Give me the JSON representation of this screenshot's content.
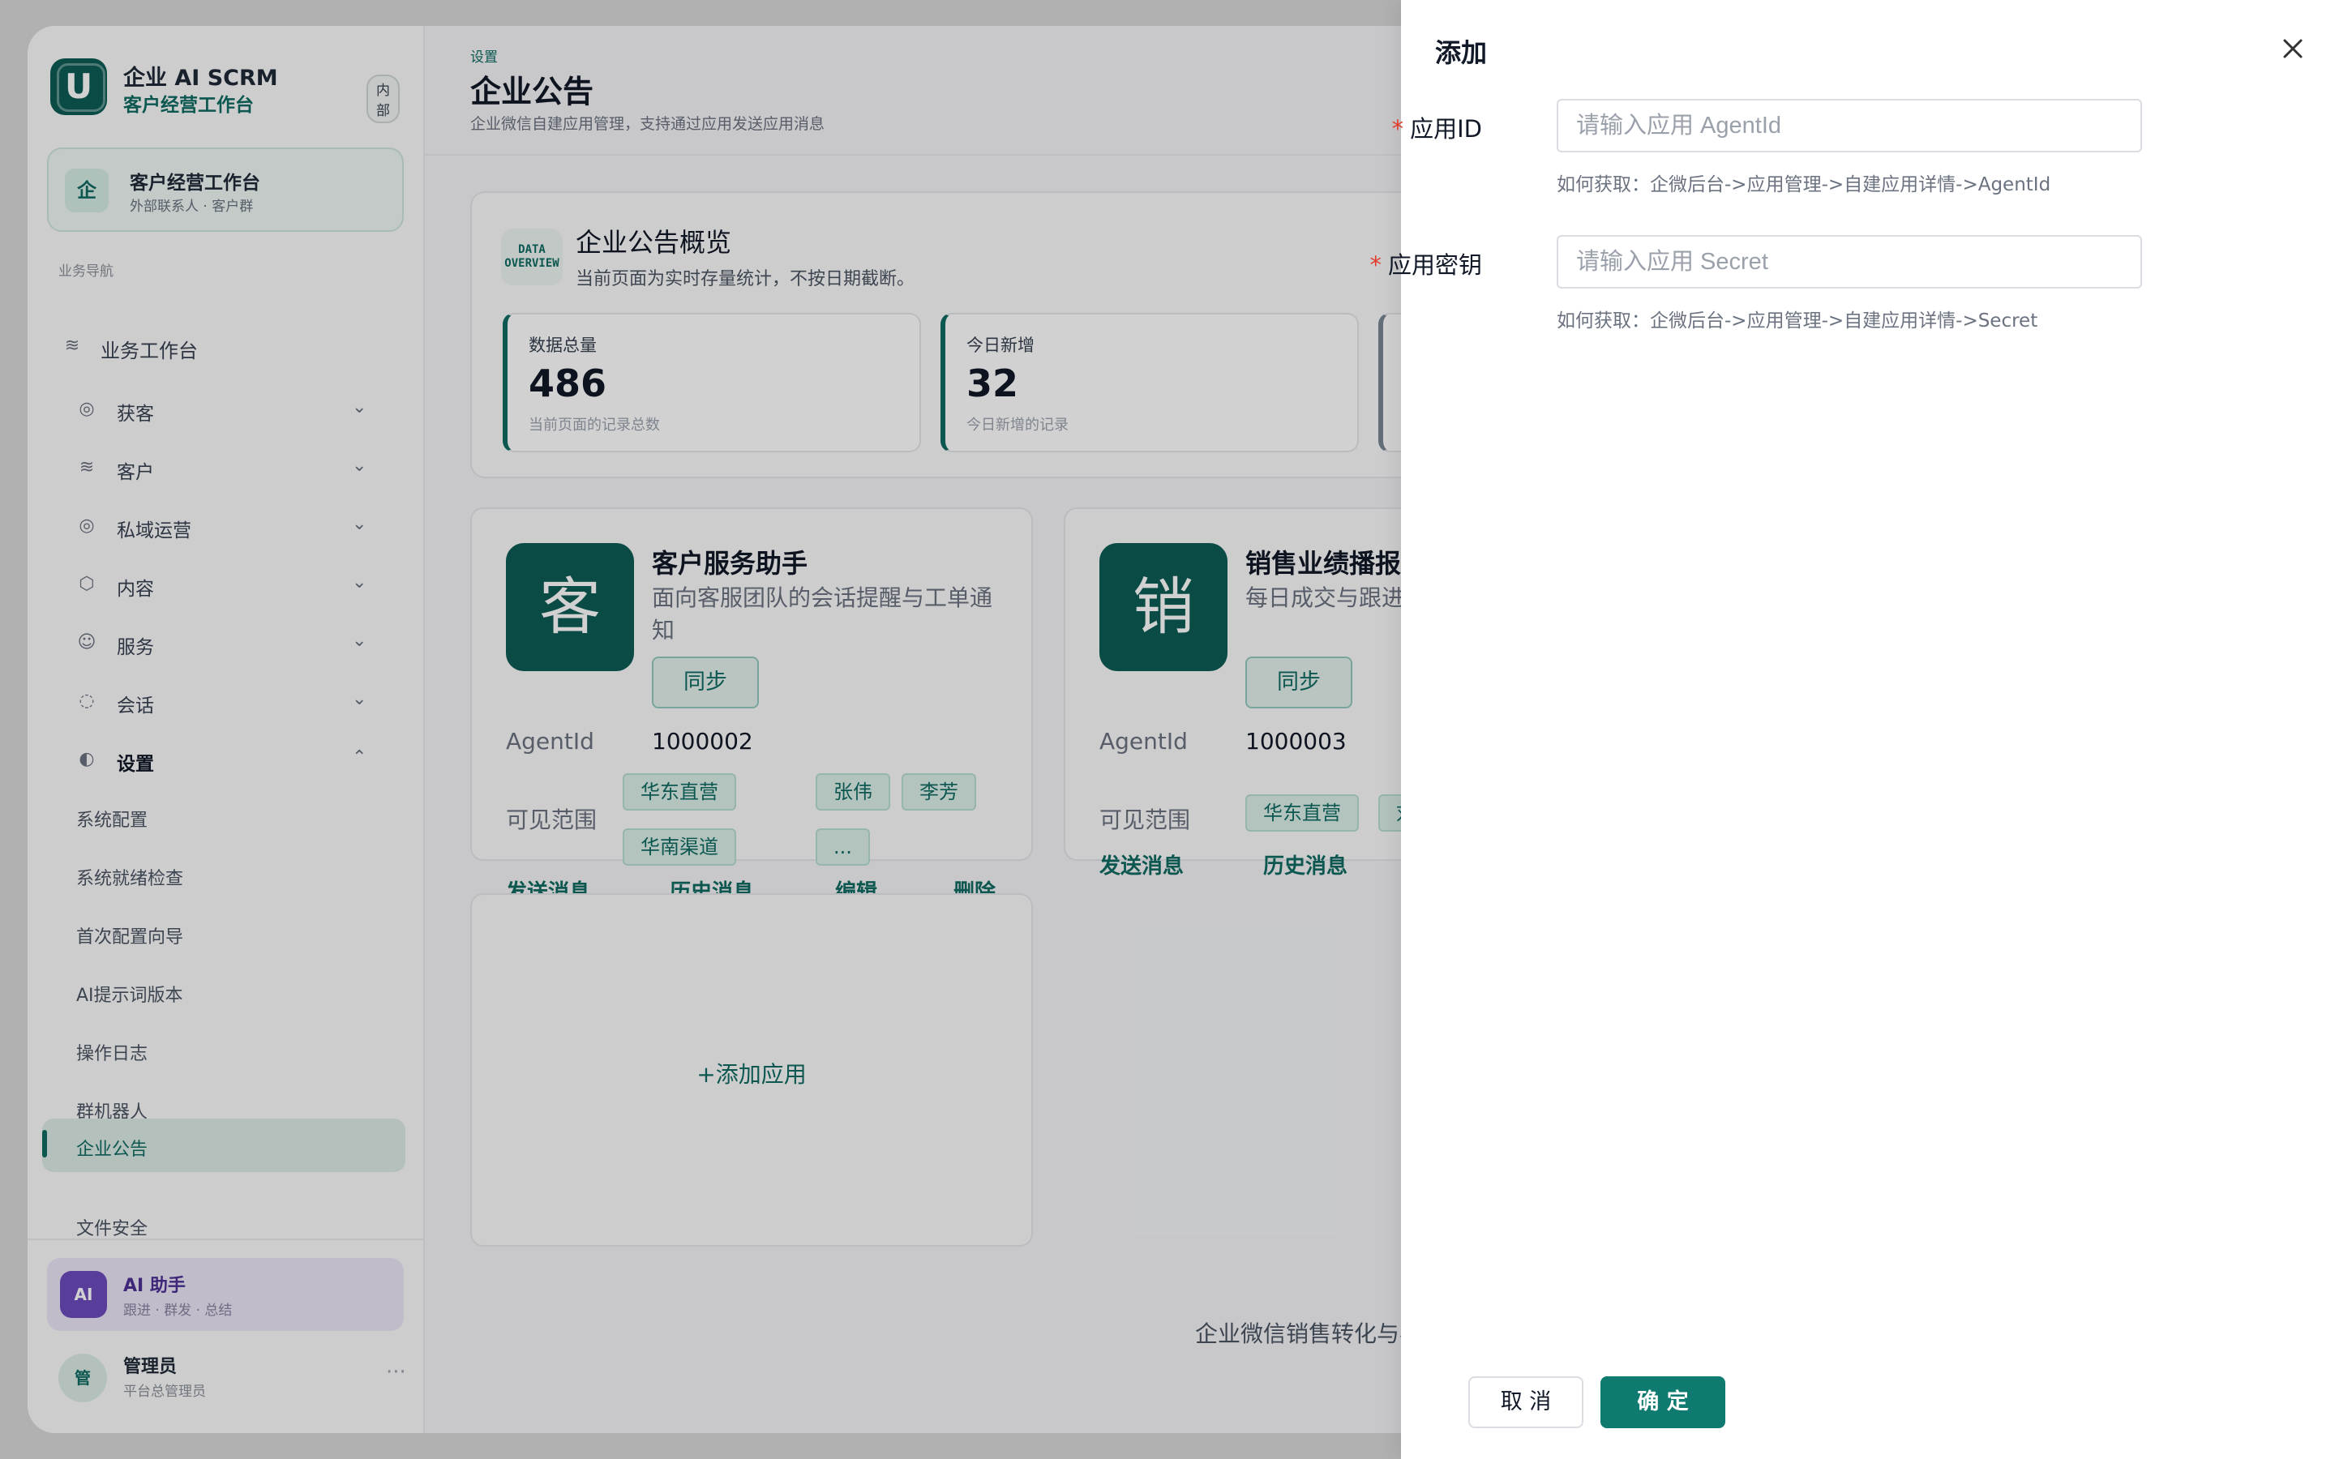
{
  "brand": {
    "name": "企业 AI SCRM",
    "subtitle": "客户经营工作台",
    "badge": "内部",
    "logo_letter": "U"
  },
  "workspace": {
    "icon": "企",
    "title": "客户经营工作台",
    "subtitle": "外部联系人 · 客户群"
  },
  "sidebar": {
    "section_label": "业务导航",
    "top_item": "业务工作台",
    "groups": [
      {
        "label": "获客",
        "icon": "target-icon"
      },
      {
        "label": "客户",
        "icon": "layers-icon"
      },
      {
        "label": "私域运营",
        "icon": "target-icon"
      },
      {
        "label": "内容",
        "icon": "box-icon"
      },
      {
        "label": "服务",
        "icon": "headset-icon"
      },
      {
        "label": "会话",
        "icon": "chat-icon"
      },
      {
        "label": "设置",
        "icon": "settings-icon"
      }
    ],
    "settings_items": [
      "系统配置",
      "系统就绪检查",
      "首次配置向导",
      "AI提示词版本",
      "操作日志",
      "群机器人",
      "企业公告",
      "文件安全"
    ],
    "active_item": "企业公告"
  },
  "ai_assistant": {
    "icon": "AI",
    "title": "AI 助手",
    "subtitle": "跟进 · 群发 · 总结"
  },
  "admin": {
    "avatar": "管",
    "name": "管理员",
    "role": "平台总管理员",
    "more": "···"
  },
  "page": {
    "breadcrumb": "设置",
    "title": "企业公告",
    "description": "企业微信自建应用管理，支持通过应用发送应用消息"
  },
  "overview": {
    "icon_text_1": "DATA",
    "icon_text_2": "OVERVIEW",
    "title": "企业公告概览",
    "description": "当前页面为实时存量统计，不按日期截断。",
    "stats": [
      {
        "label": "数据总量",
        "value": "486",
        "hint": "当前页面的记录总数"
      },
      {
        "label": "今日新增",
        "value": "32",
        "hint": "今日新增的记录"
      }
    ]
  },
  "apps": [
    {
      "icon": "客",
      "name": "客户服务助手",
      "description": "面向客服团队的会话提醒与工单通知",
      "sync": "同步",
      "agent_label": "AgentId",
      "agent_id": "1000002",
      "scope_label": "可见范围",
      "tags": [
        "华东直营",
        "张伟",
        "李芳",
        "华南渠道",
        "..."
      ],
      "actions": [
        "发送消息",
        "历史消息",
        "编辑",
        "删除"
      ]
    },
    {
      "icon": "销",
      "name": "销售业绩播报",
      "description": "每日成交与跟进管",
      "sync": "同步",
      "agent_label": "AgentId",
      "agent_id": "1000003",
      "scope_label": "可见范围",
      "tags": [
        "华东直营",
        "刘"
      ],
      "actions": [
        "发送消息",
        "历史消息"
      ]
    }
  ],
  "add_app": "+添加应用",
  "footer_text": "企业微信销售转化与客",
  "drawer": {
    "title": "添加",
    "fields": [
      {
        "label": "应用ID",
        "value": "",
        "placeholder": "请输入应用 AgentId",
        "help": "如何获取：企微后台->应用管理->自建应用详情->AgentId"
      },
      {
        "label": "应用密钥",
        "value": "",
        "placeholder": "请输入应用 Secret",
        "help": "如何获取：企微后台->应用管理->自建应用详情->Secret"
      }
    ],
    "required_mark": "*",
    "cancel": "取 消",
    "confirm": "确 定"
  },
  "colors": {
    "brand": "#0d5c55",
    "accent": "#0f7a70",
    "required": "#e23d2c",
    "ai": "#6d4bbd"
  }
}
